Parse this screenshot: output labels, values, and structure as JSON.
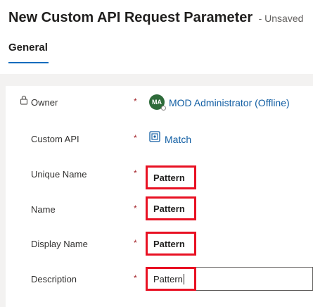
{
  "header": {
    "title": "New Custom API Request Parameter",
    "subtitle": "- Unsaved",
    "tabs": [
      {
        "label": "General",
        "active": true
      }
    ]
  },
  "form": {
    "required_marker": "*",
    "owner": {
      "label": "Owner",
      "avatar_initials": "MA",
      "value": "MOD Administrator (Offline)"
    },
    "custom_api": {
      "label": "Custom API",
      "value": "Match"
    },
    "unique_name": {
      "label": "Unique Name",
      "value": "Pattern"
    },
    "name": {
      "label": "Name",
      "value": "Pattern"
    },
    "display_name": {
      "label": "Display Name",
      "value": "Pattern"
    },
    "description": {
      "label": "Description",
      "value": "Pattern"
    }
  },
  "colors": {
    "required": "#a4262c",
    "link": "#115ea3",
    "highlight": "#e81123",
    "avatar": "#2e6b3a",
    "tab_underline": "#0f6cbd"
  },
  "icons": {
    "owner_lock": "lock-icon",
    "custom_api_entity": "entity-icon"
  }
}
